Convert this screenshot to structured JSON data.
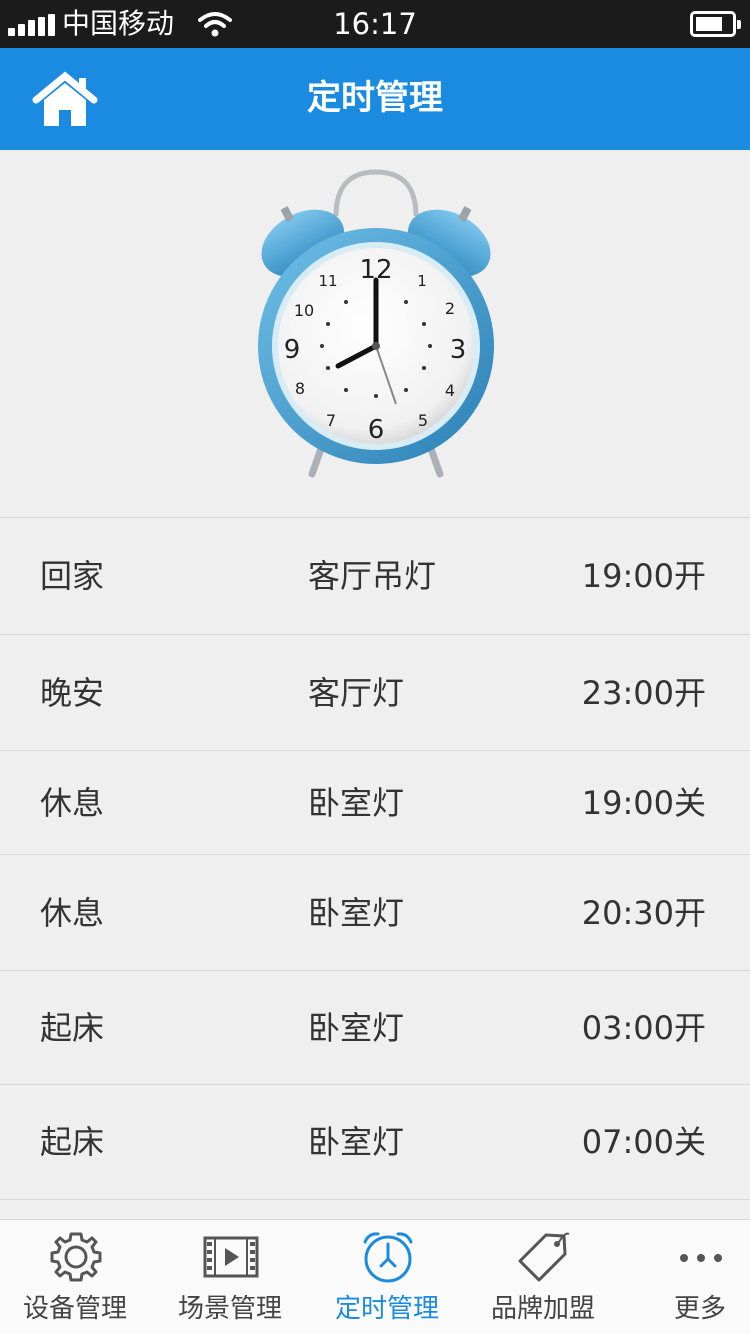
{
  "status_bar": {
    "carrier": "中国移动",
    "time": "16:17"
  },
  "header": {
    "title": "定时管理",
    "home_icon": "home-icon"
  },
  "hero": {
    "icon": "alarm-clock",
    "clock_numbers": [
      "12",
      "1",
      "2",
      "3",
      "4",
      "5",
      "6",
      "7",
      "8",
      "9",
      "10",
      "11"
    ],
    "accent_color": "#3b9ed4"
  },
  "schedules": [
    {
      "scene": "回家",
      "device": "客厅吊灯",
      "action": "19:00开"
    },
    {
      "scene": "晚安",
      "device": "客厅灯",
      "action": "23:00开"
    },
    {
      "scene": "休息",
      "device": "卧室灯",
      "action": "19:00关"
    },
    {
      "scene": "休息",
      "device": "卧室灯",
      "action": "20:30开"
    },
    {
      "scene": "起床",
      "device": "卧室灯",
      "action": "03:00开"
    },
    {
      "scene": "起床",
      "device": "卧室灯",
      "action": "07:00关"
    }
  ],
  "tabs": [
    {
      "label": "设备管理",
      "icon": "gear-icon",
      "active": false
    },
    {
      "label": "场景管理",
      "icon": "film-play-icon",
      "active": false
    },
    {
      "label": "定时管理",
      "icon": "alarm-clock-icon",
      "active": true
    },
    {
      "label": "品牌加盟",
      "icon": "tag-icon",
      "active": false
    },
    {
      "label": "更多",
      "icon": "more-icon",
      "active": false
    }
  ],
  "colors": {
    "header_bg": "#1a8be0",
    "active_tab": "#1a8be0",
    "inactive_tab": "#555555",
    "status_bar_bg": "#1b1b1b"
  }
}
